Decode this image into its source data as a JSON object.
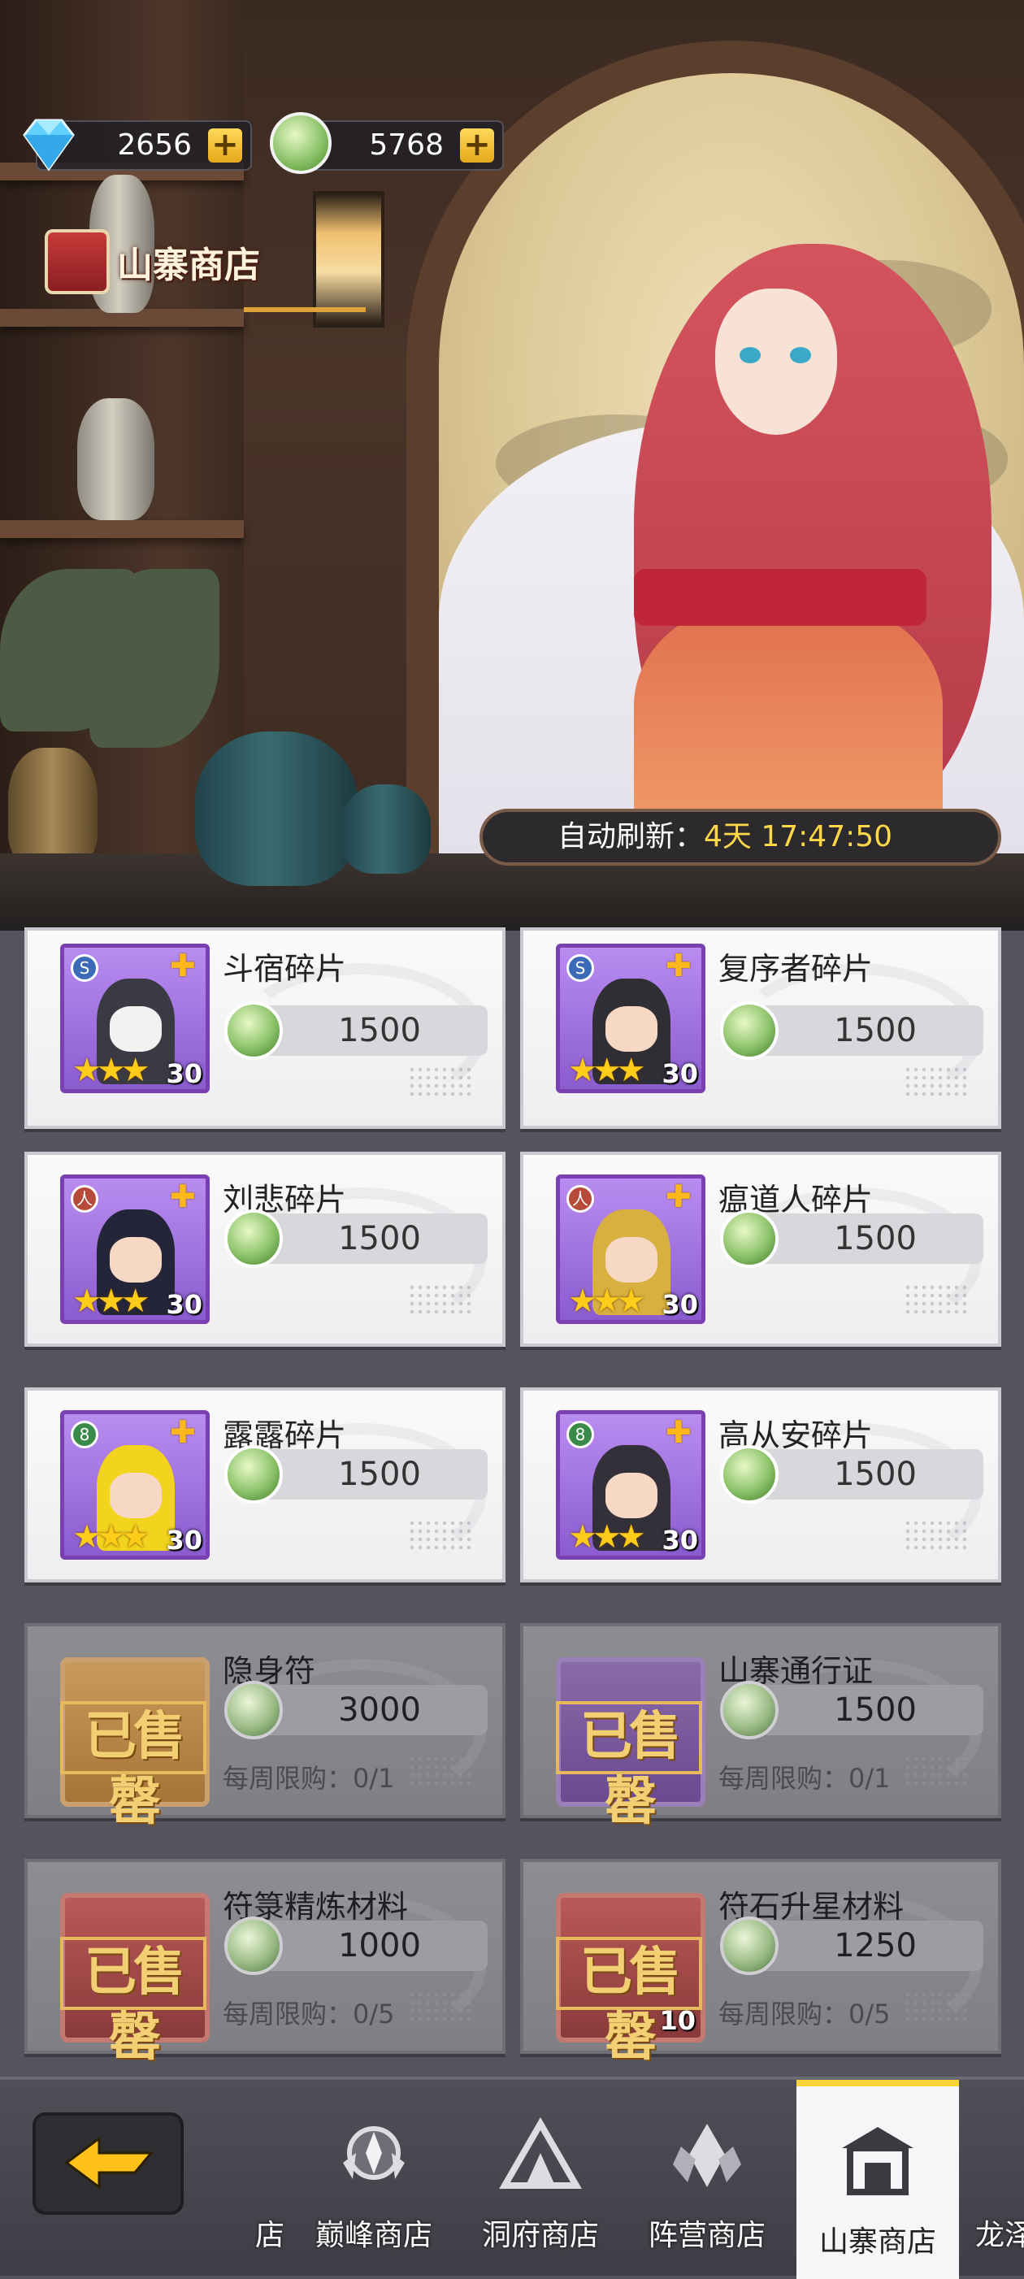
{
  "currency": {
    "diamonds": "2656",
    "coins": "5768",
    "add_symbol": "+"
  },
  "header": {
    "shop_title": "山寨商店",
    "refresh_label": "自动刷新：",
    "refresh_time": "4天 17:47:50"
  },
  "items": [
    {
      "name": "斗宿碎片",
      "price": "1500",
      "qty": "30",
      "stars": "★★★",
      "badge": "S"
    },
    {
      "name": "复序者碎片",
      "price": "1500",
      "qty": "30",
      "stars": "★★★",
      "badge": "S"
    },
    {
      "name": "刘悲碎片",
      "price": "1500",
      "qty": "30",
      "stars": "★★★",
      "badge": "人"
    },
    {
      "name": "瘟道人碎片",
      "price": "1500",
      "qty": "30",
      "stars": "★★★",
      "badge": "人"
    },
    {
      "name": "露露碎片",
      "price": "1500",
      "qty": "30",
      "stars": "★★★",
      "badge": "8"
    },
    {
      "name": "高从安碎片",
      "price": "1500",
      "qty": "30",
      "stars": "★★★",
      "badge": "8"
    },
    {
      "name": "隐身符",
      "price": "3000",
      "limit": "每周限购：0/1",
      "soldout": "已售罄"
    },
    {
      "name": "山寨通行证",
      "price": "1500",
      "limit": "每周限购：0/1",
      "soldout": "已售罄"
    },
    {
      "name": "符箓精炼材料",
      "price": "1000",
      "limit": "每周限购：0/5",
      "soldout": "已售罄"
    },
    {
      "name": "符石升星材料",
      "price": "1250",
      "limit": "每周限购：0/5",
      "soldout": "已售罄",
      "qty": "10"
    }
  ],
  "nav": {
    "items": [
      {
        "label": "店",
        "icon": "partial-shop-icon"
      },
      {
        "label": "巅峰商店",
        "icon": "peak-shop-icon"
      },
      {
        "label": "洞府商店",
        "icon": "cave-shop-icon"
      },
      {
        "label": "阵营商店",
        "icon": "faction-shop-icon"
      },
      {
        "label": "山寨商店",
        "icon": "fortress-shop-icon",
        "active": true
      },
      {
        "label": "龙泽",
        "icon": "dragon-shop-icon"
      }
    ]
  }
}
